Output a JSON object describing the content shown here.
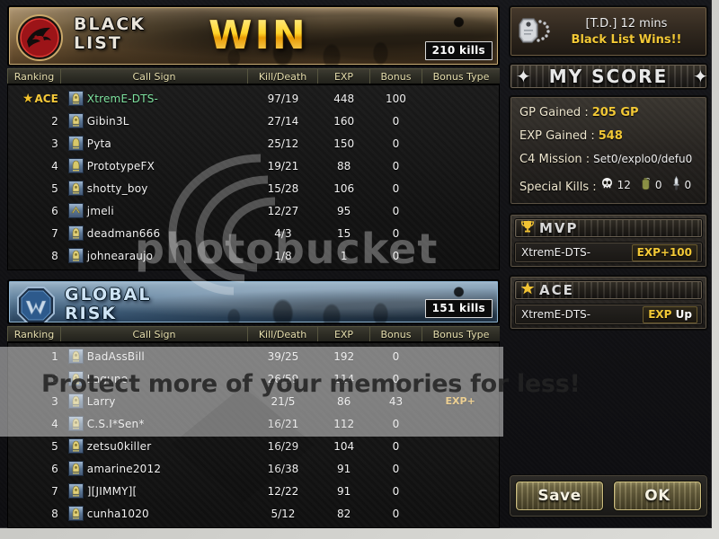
{
  "match": {
    "mode_time": "[T.D.] 12 mins",
    "result": "Black List Wins!!",
    "win_label": "WIN"
  },
  "columns": {
    "ranking": "Ranking",
    "call_sign": "Call Sign",
    "kill_death": "Kill/Death",
    "exp": "EXP",
    "bonus": "Bonus",
    "bonus_type": "Bonus Type"
  },
  "teams": [
    {
      "id": "black-list",
      "name_line1": "BLACK",
      "name_line2": "LIST",
      "kills": "210 kills",
      "emblem": "blacklist-emblem",
      "players": [
        {
          "rank": "ACE",
          "is_ace": true,
          "name": "XtremE-DTS-",
          "is_me": true,
          "kd": "97/19",
          "exp": "448",
          "bonus": "100",
          "bonus_type": "",
          "badge": "rank-badge-1"
        },
        {
          "rank": "2",
          "is_ace": false,
          "name": "Gibin3L",
          "is_me": false,
          "kd": "27/14",
          "exp": "160",
          "bonus": "0",
          "bonus_type": "",
          "badge": "rank-badge-1"
        },
        {
          "rank": "3",
          "is_ace": false,
          "name": "Pyta",
          "is_me": false,
          "kd": "25/12",
          "exp": "150",
          "bonus": "0",
          "bonus_type": "",
          "badge": "rank-badge-2"
        },
        {
          "rank": "4",
          "is_ace": false,
          "name": "PrototypeFX",
          "is_me": false,
          "kd": "19/21",
          "exp": "88",
          "bonus": "0",
          "bonus_type": "",
          "badge": "rank-badge-2"
        },
        {
          "rank": "5",
          "is_ace": false,
          "name": "shotty_boy",
          "is_me": false,
          "kd": "15/28",
          "exp": "106",
          "bonus": "0",
          "bonus_type": "",
          "badge": "rank-badge-1"
        },
        {
          "rank": "6",
          "is_ace": false,
          "name": "jmeli",
          "is_me": false,
          "kd": "12/27",
          "exp": "95",
          "bonus": "0",
          "bonus_type": "",
          "badge": "rank-badge-3"
        },
        {
          "rank": "7",
          "is_ace": false,
          "name": "deadman666",
          "is_me": false,
          "kd": "4/3",
          "exp": "15",
          "bonus": "0",
          "bonus_type": "",
          "badge": "rank-badge-1"
        },
        {
          "rank": "8",
          "is_ace": false,
          "name": "johnearaujo",
          "is_me": false,
          "kd": "1/8",
          "exp": "1",
          "bonus": "0",
          "bonus_type": "",
          "badge": "rank-badge-1"
        }
      ]
    },
    {
      "id": "global-risk",
      "name_line1": "GLOBAL",
      "name_line2": "RISK",
      "kills": "151 kills",
      "emblem": "globalrisk-emblem",
      "players": [
        {
          "rank": "1",
          "is_ace": false,
          "name": "BadAssBill",
          "is_me": false,
          "kd": "39/25",
          "exp": "192",
          "bonus": "0",
          "bonus_type": "",
          "badge": "rank-badge-1"
        },
        {
          "rank": "2",
          "is_ace": false,
          "name": "Lagune",
          "is_me": false,
          "kd": "26/59",
          "exp": "114",
          "bonus": "0",
          "bonus_type": "",
          "badge": "rank-badge-1"
        },
        {
          "rank": "3",
          "is_ace": false,
          "name": "Larry",
          "is_me": false,
          "kd": "21/5",
          "exp": "86",
          "bonus": "43",
          "bonus_type": "EXP+",
          "badge": "rank-badge-1"
        },
        {
          "rank": "4",
          "is_ace": false,
          "name": "C.S.I*Sen*",
          "is_me": false,
          "kd": "16/21",
          "exp": "112",
          "bonus": "0",
          "bonus_type": "",
          "badge": "rank-badge-1"
        },
        {
          "rank": "5",
          "is_ace": false,
          "name": "zetsu0killer",
          "is_me": false,
          "kd": "16/29",
          "exp": "104",
          "bonus": "0",
          "bonus_type": "",
          "badge": "rank-badge-1"
        },
        {
          "rank": "6",
          "is_ace": false,
          "name": "amarine2012",
          "is_me": false,
          "kd": "16/38",
          "exp": "91",
          "bonus": "0",
          "bonus_type": "",
          "badge": "rank-badge-1"
        },
        {
          "rank": "7",
          "is_ace": false,
          "name": "][JIMMY][",
          "is_me": false,
          "kd": "12/22",
          "exp": "91",
          "bonus": "0",
          "bonus_type": "",
          "badge": "rank-badge-1"
        },
        {
          "rank": "8",
          "is_ace": false,
          "name": "cunha1020",
          "is_me": false,
          "kd": "5/12",
          "exp": "82",
          "bonus": "0",
          "bonus_type": "",
          "badge": "rank-badge-1"
        }
      ]
    }
  ],
  "my_score": {
    "title": "MY SCORE",
    "gp_label": "GP Gained :",
    "gp_value": "205 GP",
    "exp_label": "EXP Gained :",
    "exp_value": "548",
    "c4_label": "C4 Mission :",
    "c4_value": "Set0/explo0/defu0",
    "special_label": "Special Kills :",
    "headshot_count": "12",
    "grenade_count": "0",
    "knife_count": "0"
  },
  "awards": [
    {
      "id": "mvp",
      "title": "MVP",
      "icon": "trophy-icon",
      "player": "XtremE-DTS-",
      "reward": "EXP+100",
      "reward_suffix": ""
    },
    {
      "id": "ace",
      "title": "ACE",
      "icon": "star-icon",
      "player": "XtremE-DTS-",
      "reward": "EXP",
      "reward_suffix": " Up"
    }
  ],
  "buttons": {
    "save": "Save",
    "ok": "OK"
  },
  "watermark": {
    "word": "photobucket",
    "tagline": "Protect more of your memories for less!"
  },
  "colors": {
    "gold": "#f2c836",
    "me_green": "#7fe3a0",
    "blacklist_red": "#b81f22",
    "globalrisk_blue": "#4a7fb5"
  }
}
